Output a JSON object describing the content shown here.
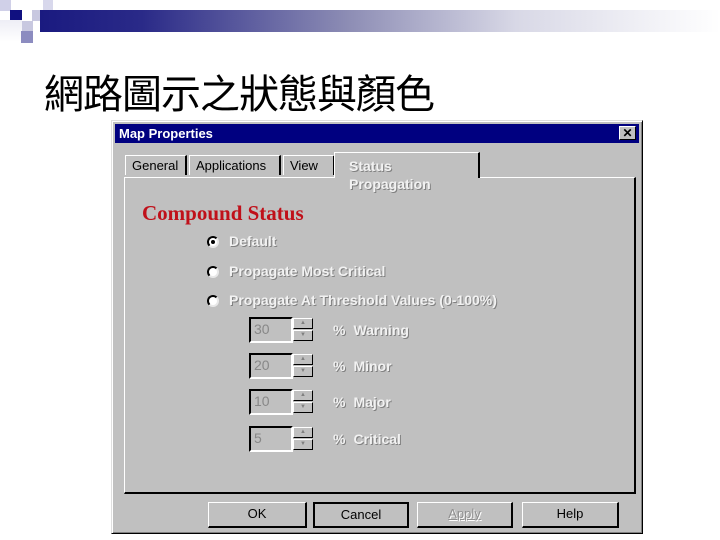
{
  "slide": {
    "title": "網路圖示之狀態與顏色"
  },
  "dialog": {
    "title": "Map Properties",
    "close_glyph": "✕",
    "tabs": [
      {
        "label": "General",
        "active": false
      },
      {
        "label": "Applications",
        "active": false
      },
      {
        "label": "View",
        "active": false
      },
      {
        "label": "Status Propagation",
        "label_line1": "Status",
        "label_line2": "Propagation",
        "active": true
      }
    ],
    "section_title": "Compound Status",
    "section_title_color": "#c0101a",
    "radio_options": [
      {
        "label": "Default",
        "checked": true
      },
      {
        "label": "Propagate Most Critical",
        "checked": false
      },
      {
        "label": "Propagate At Threshold Values (0-100%)",
        "checked": false
      }
    ],
    "thresholds": [
      {
        "value": "30",
        "unit": "%",
        "label": "Warning"
      },
      {
        "value": "20",
        "unit": "%",
        "label": "Minor"
      },
      {
        "value": "10",
        "unit": "%",
        "label": "Major"
      },
      {
        "value": "5",
        "unit": "%",
        "label": "Critical"
      }
    ],
    "spin_up_glyph": "▲",
    "spin_down_glyph": "▼",
    "buttons": {
      "ok": "OK",
      "cancel": "Cancel",
      "apply": "Apply",
      "help": "Help"
    },
    "titlebar_color": "#000080"
  }
}
